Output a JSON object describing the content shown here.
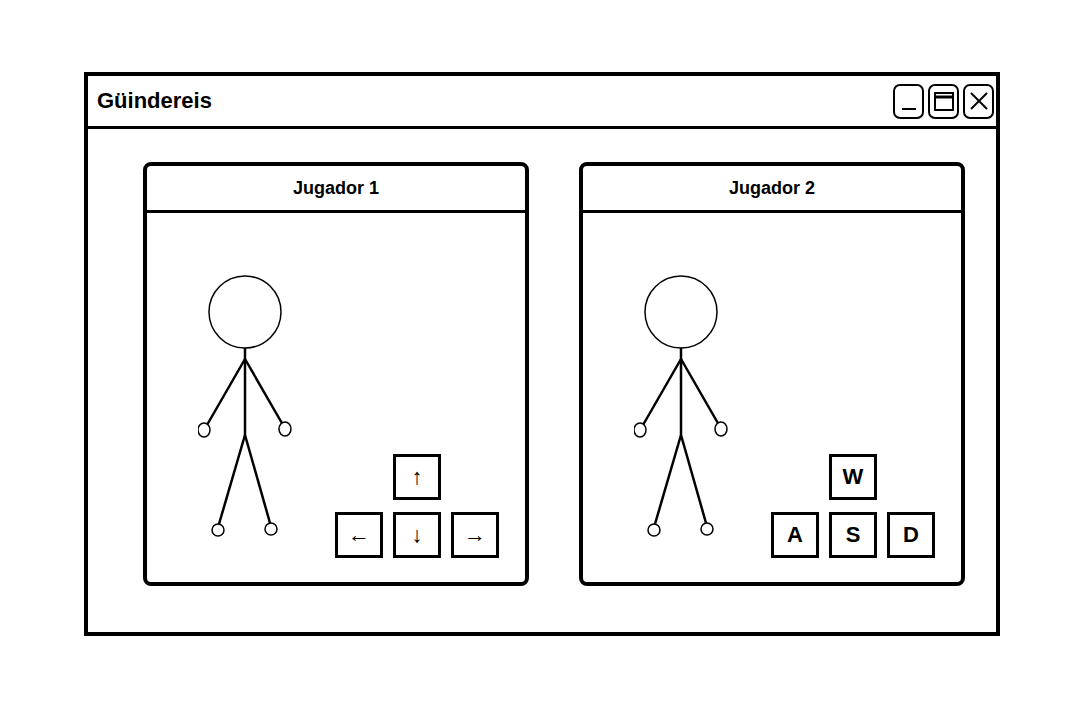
{
  "window": {
    "title": "Güindereis"
  },
  "players": [
    {
      "name": "Jugador 1",
      "keys": {
        "up": "↑",
        "left": "←",
        "down": "↓",
        "right": "→"
      }
    },
    {
      "name": "Jugador 2",
      "keys": {
        "up": "W",
        "left": "A",
        "down": "S",
        "right": "D"
      }
    }
  ]
}
